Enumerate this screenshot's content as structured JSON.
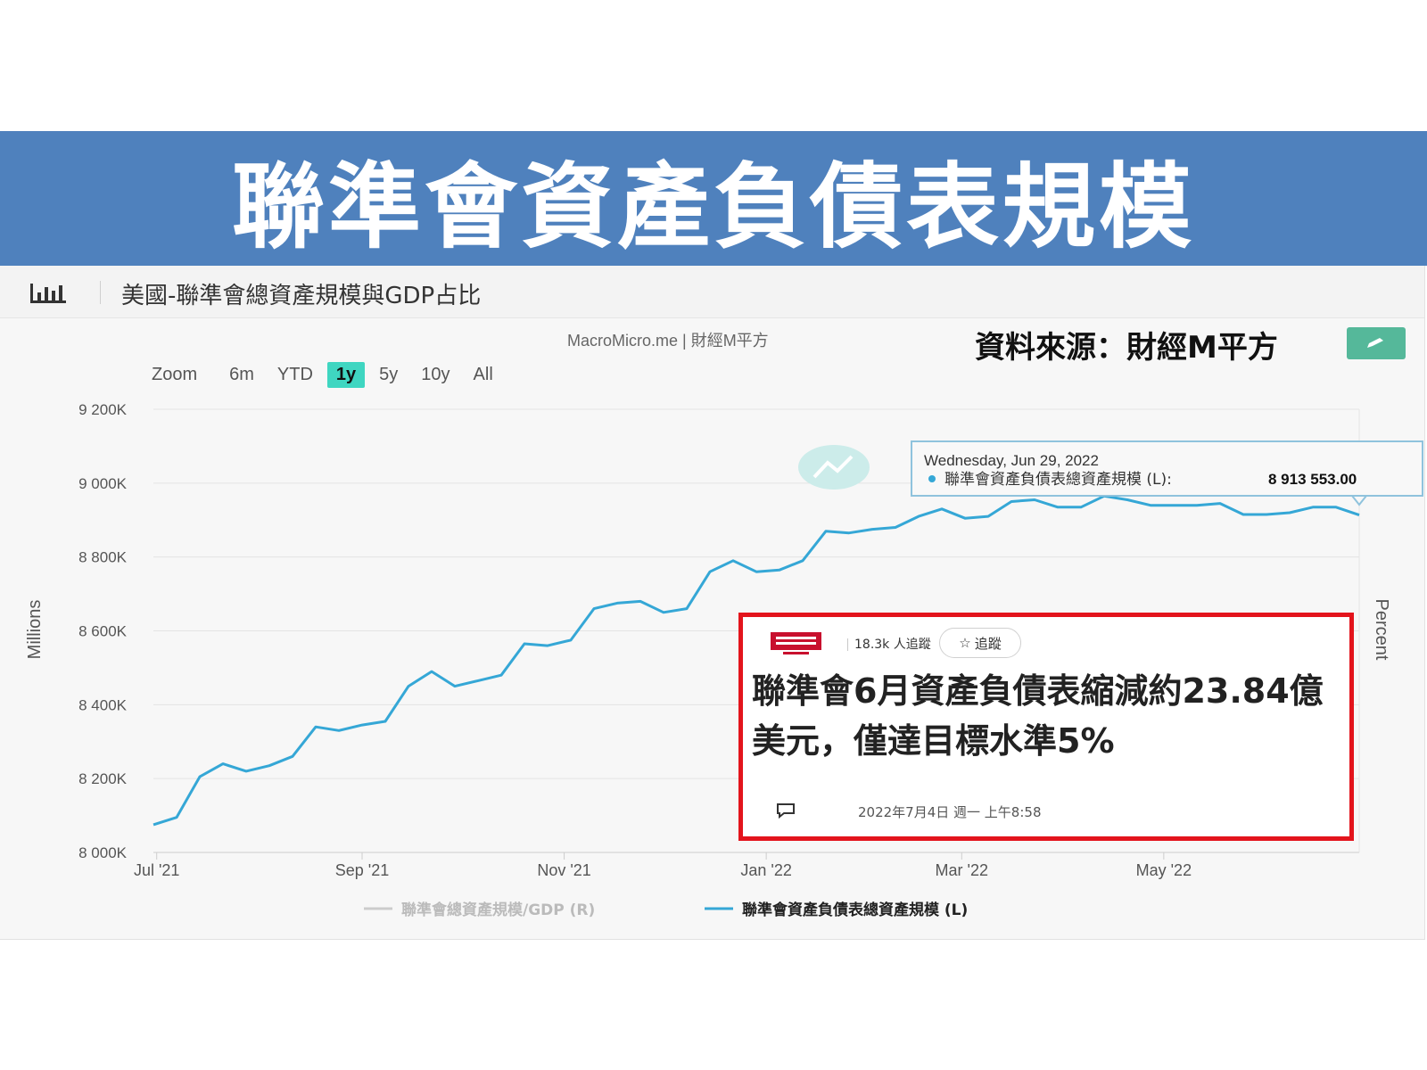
{
  "banner": {
    "title": "聯準會資產負債表規模"
  },
  "panel": {
    "title": "美國-聯準會總資產規模與GDP占比",
    "credits": "MacroMicro.me | 財經M平方",
    "source_label": "資料來源：財經M平方",
    "icons": {
      "chart": "bar-chart-icon",
      "edit": "pencil-icon",
      "hint": "line-chart-icon"
    }
  },
  "zoom": {
    "label": "Zoom",
    "buttons": [
      "6m",
      "YTD",
      "1y",
      "5y",
      "10y",
      "All"
    ],
    "active": "1y"
  },
  "tooltip": {
    "date": "Wednesday, Jun 29, 2022",
    "series": "聯準會資產負債表總資產規模 (L):",
    "value": "8 913 553.00"
  },
  "news": {
    "followers": "18.3k 人追蹤",
    "follow_label": "追蹤",
    "headline_line1": "聯準會6月資產負債表縮減約23.84億",
    "headline_line2": "美元，僅達目標水準5%",
    "timestamp": "2022年7月4日 週一 上午8:58",
    "icons": {
      "logo": "newspaper-logo",
      "follow": "star-icon",
      "comment": "comment-icon"
    }
  },
  "chart_data": {
    "type": "line",
    "title": "美國-聯準會總資產規模與GDP占比",
    "ylabel": "Millions",
    "ylabel_right": "Percent",
    "ylim": [
      8000000,
      9200000
    ],
    "yticks": [
      8000000,
      8200000,
      8400000,
      8600000,
      8800000,
      9000000,
      9200000
    ],
    "ytick_labels": [
      "8 000K",
      "8 200K",
      "8 400K",
      "8 600K",
      "8 800K",
      "9 000K",
      "9 200K"
    ],
    "xlim": [
      "2021-06-30",
      "2022-06-29"
    ],
    "xtick_dates": [
      "2021-07-01",
      "2021-09-01",
      "2021-11-01",
      "2022-01-01",
      "2022-03-01",
      "2022-05-01"
    ],
    "xtick_labels": [
      "Jul '21",
      "Sep '21",
      "Nov '21",
      "Jan '22",
      "Mar '22",
      "May '22"
    ],
    "legend": {
      "placement": "bottom-center"
    },
    "grid": true,
    "series": [
      {
        "name": "聯準會總資產規模/GDP (R)",
        "color": "#cccccc",
        "visible": false,
        "x": [],
        "values": []
      },
      {
        "name": "聯準會資產負債表總資產規模 (L)",
        "color": "#35a7d6",
        "visible": true,
        "x": [
          "2021-06-30",
          "2021-07-07",
          "2021-07-14",
          "2021-07-21",
          "2021-07-28",
          "2021-08-04",
          "2021-08-11",
          "2021-08-18",
          "2021-08-25",
          "2021-09-01",
          "2021-09-08",
          "2021-09-15",
          "2021-09-22",
          "2021-09-29",
          "2021-10-06",
          "2021-10-13",
          "2021-10-20",
          "2021-10-27",
          "2021-11-03",
          "2021-11-10",
          "2021-11-17",
          "2021-11-24",
          "2021-12-01",
          "2021-12-08",
          "2021-12-15",
          "2021-12-22",
          "2021-12-29",
          "2022-01-05",
          "2022-01-12",
          "2022-01-19",
          "2022-01-26",
          "2022-02-02",
          "2022-02-09",
          "2022-02-16",
          "2022-02-23",
          "2022-03-02",
          "2022-03-09",
          "2022-03-16",
          "2022-03-23",
          "2022-03-30",
          "2022-04-06",
          "2022-04-13",
          "2022-04-20",
          "2022-04-27",
          "2022-05-04",
          "2022-05-11",
          "2022-05-18",
          "2022-05-25",
          "2022-06-01",
          "2022-06-08",
          "2022-06-15",
          "2022-06-22",
          "2022-06-29"
        ],
        "values": [
          8075000,
          8095000,
          8205000,
          8240000,
          8220000,
          8235000,
          8260000,
          8340000,
          8330000,
          8345000,
          8355000,
          8450000,
          8490000,
          8450000,
          8465000,
          8480000,
          8565000,
          8560000,
          8575000,
          8660000,
          8675000,
          8680000,
          8650000,
          8660000,
          8760000,
          8790000,
          8760000,
          8765000,
          8790000,
          8870000,
          8865000,
          8875000,
          8880000,
          8910000,
          8930000,
          8905000,
          8910000,
          8950000,
          8955000,
          8935000,
          8935000,
          8965000,
          8955000,
          8940000,
          8940000,
          8940000,
          8945000,
          8915000,
          8915000,
          8920000,
          8935000,
          8935000,
          8913553
        ]
      }
    ]
  }
}
